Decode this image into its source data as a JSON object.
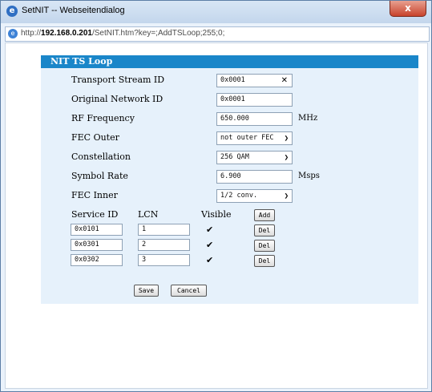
{
  "window": {
    "title": "SetNIT -- Webseitendialog",
    "close_label": "x"
  },
  "address": {
    "prefix": "http://",
    "host": "192.168.0.201",
    "path": "/SetNIT.htm?key=;AddTSLoop;255;0;"
  },
  "panel": {
    "title": "NIT TS Loop",
    "transport_stream_id": {
      "label": "Transport Stream ID",
      "value": "0x0001"
    },
    "original_network_id": {
      "label": "Original Network ID",
      "value": "0x0001"
    },
    "rf_frequency": {
      "label": "RF Frequency",
      "value": "650.000",
      "unit": "MHz"
    },
    "fec_outer": {
      "label": "FEC Outer",
      "value": "not outer FEC"
    },
    "constellation": {
      "label": "Constellation",
      "value": "256 QAM"
    },
    "symbol_rate": {
      "label": "Symbol Rate",
      "value": "6.900",
      "unit": "Msps"
    },
    "fec_inner": {
      "label": "FEC Inner",
      "value": "1/2 conv."
    },
    "services": {
      "headers": {
        "service_id": "Service ID",
        "lcn": "LCN",
        "visible": "Visible"
      },
      "add_label": "Add",
      "rows": [
        {
          "service_id": "0x0101",
          "lcn": "1",
          "visible": true,
          "del_label": "Del"
        },
        {
          "service_id": "0x0301",
          "lcn": "2",
          "visible": true,
          "del_label": "Del"
        },
        {
          "service_id": "0x0302",
          "lcn": "3",
          "visible": true,
          "del_label": "Del"
        }
      ]
    },
    "save_label": "Save",
    "cancel_label": "Cancel"
  }
}
